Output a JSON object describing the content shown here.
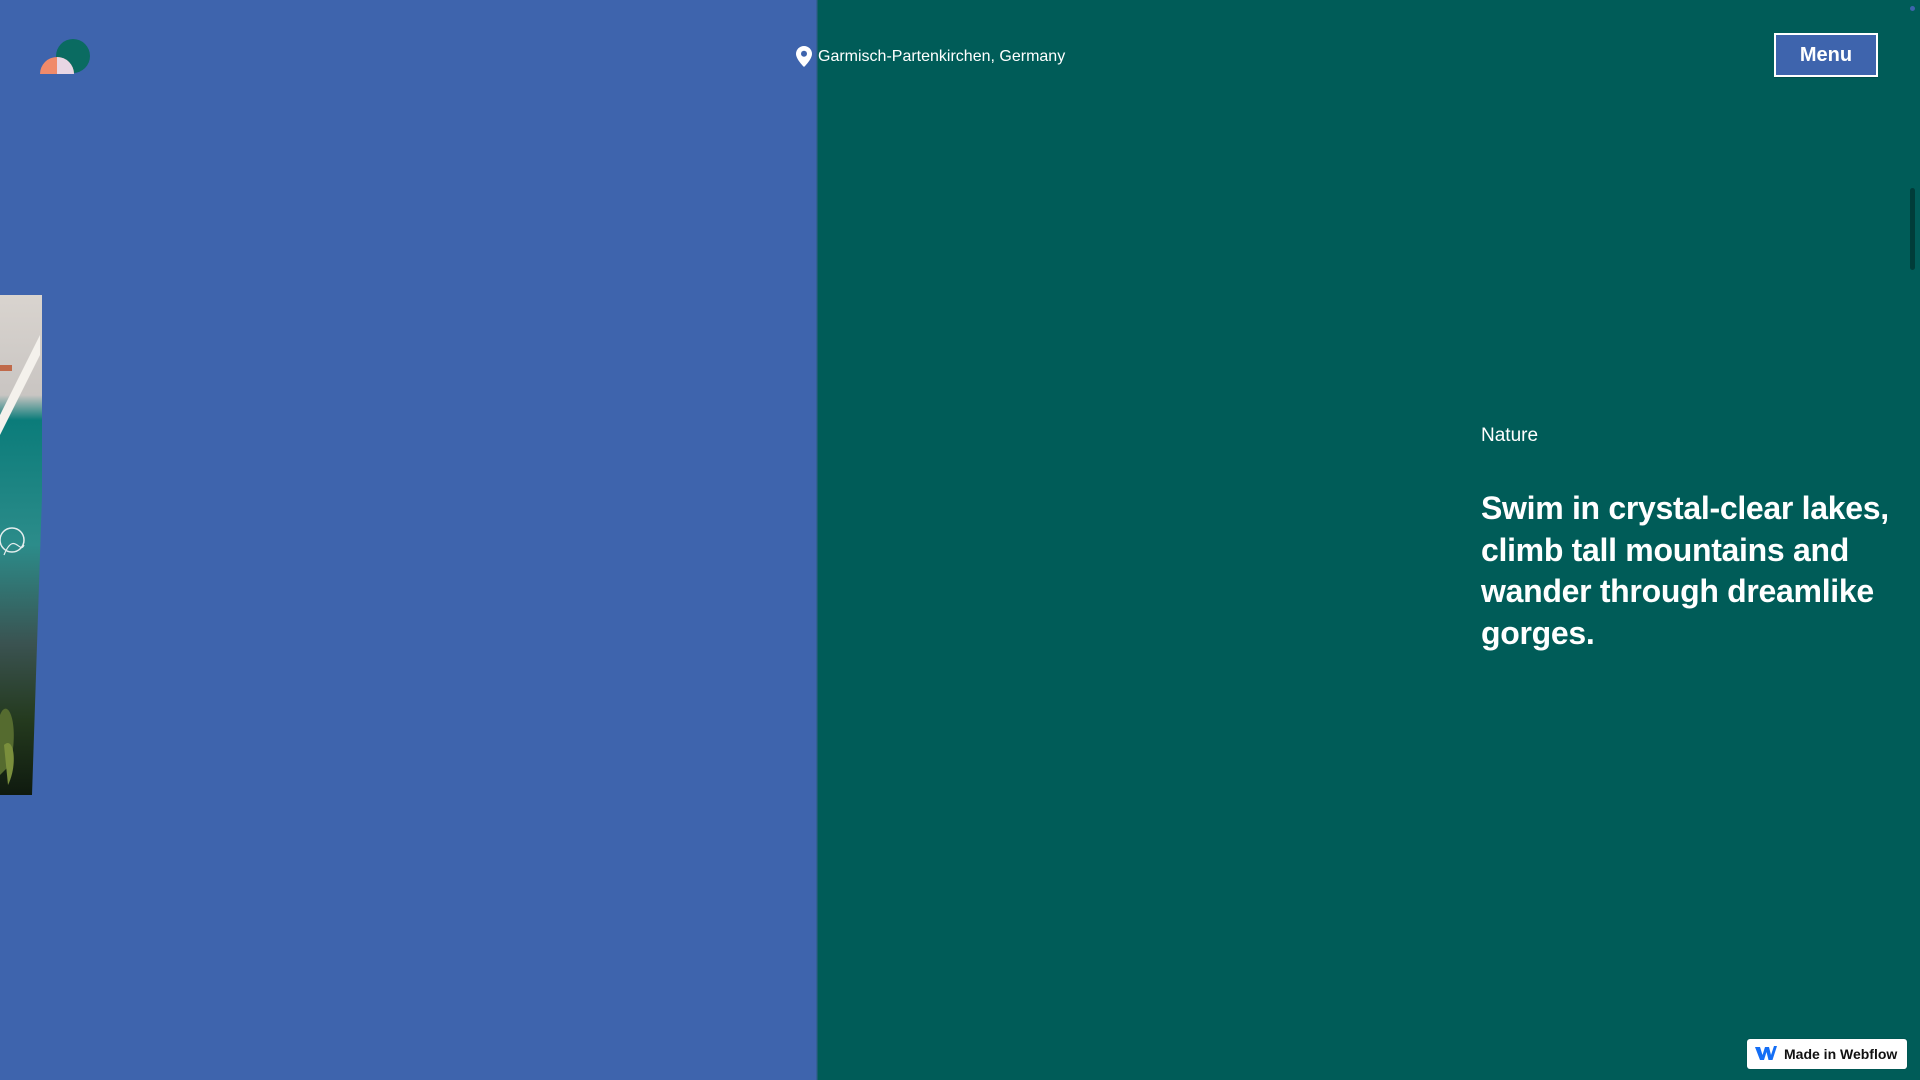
{
  "header": {
    "logo_icon": "brand-logo-icon",
    "location_icon": "map-pin-icon",
    "location_text": "Garmisch-Partenkirchen, Germany",
    "menu_label": "Menu"
  },
  "content": {
    "eyebrow": "Nature",
    "headline": "Swim in crystal-clear lakes, climb tall mountains and wander through dreamlike gorges."
  },
  "badge": {
    "icon": "webflow-logo-icon",
    "label": "Made in Webflow"
  },
  "colors": {
    "left_panel": "#3e64ad",
    "right_panel": "#005c58",
    "logo_coral": "#f08a6a",
    "logo_teal": "#0a6b61",
    "webflow_blue": "#146ef5"
  }
}
